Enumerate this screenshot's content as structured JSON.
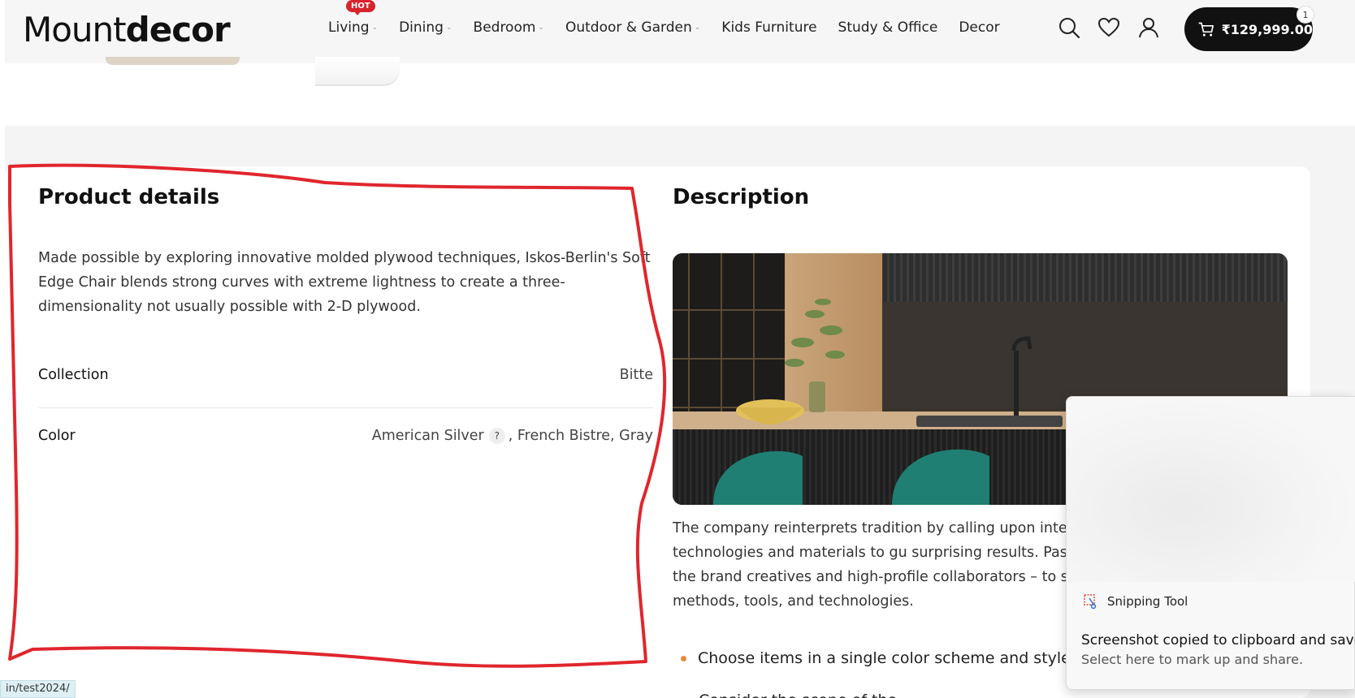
{
  "header": {
    "logo_part1": "Mount",
    "logo_part2": "decor",
    "nav": [
      {
        "label": "Living",
        "badge": "HOT",
        "has_dropdown": true
      },
      {
        "label": "Dining",
        "has_dropdown": true
      },
      {
        "label": "Bedroom",
        "has_dropdown": true
      },
      {
        "label": "Outdoor & Garden",
        "has_dropdown": true
      },
      {
        "label": "Kids Furniture",
        "has_dropdown": false
      },
      {
        "label": "Study & Office",
        "has_dropdown": false
      },
      {
        "label": "Decor",
        "has_dropdown": false
      }
    ],
    "icons": [
      "search-icon",
      "heart-icon",
      "user-icon",
      "cart-icon"
    ],
    "cart_total": "₹129,999.00",
    "cart_count": "1"
  },
  "product_details": {
    "title": "Product details",
    "text": "Made possible by exploring innovative molded plywood techniques, Iskos-Berlin's Soft Edge Chair blends strong curves with extreme lightness to create a three-dimensionality not usually possible with 2-D plywood.",
    "attributes": [
      {
        "label": "Collection",
        "value": "Bitte"
      },
      {
        "label": "Color",
        "value_pre": "American Silver",
        "help": "?",
        "value_post": ", French Bistre, Gray"
      }
    ]
  },
  "description": {
    "title": "Description",
    "text": "The company reinterprets tradition by calling upon internat them and developing new technologies and materials to gu surprising results. Passion is the engine that drives the brand creatives and high-profile collaborators – to search for origi materials, methods, tools, and technologies.",
    "bullets": [
      "Choose items in a single color scheme and style",
      "Consider the scope of the"
    ]
  },
  "toast": {
    "app": "Snipping Tool",
    "title": "Screenshot copied to clipboard and saved",
    "subtitle": "Select here to mark up and share."
  },
  "status_url": "in/test2024/",
  "colors": {
    "annotation": "#e0262d",
    "hot_badge": "#d8232a",
    "cart_bg": "#111111",
    "bullet": "#e58a3c"
  }
}
